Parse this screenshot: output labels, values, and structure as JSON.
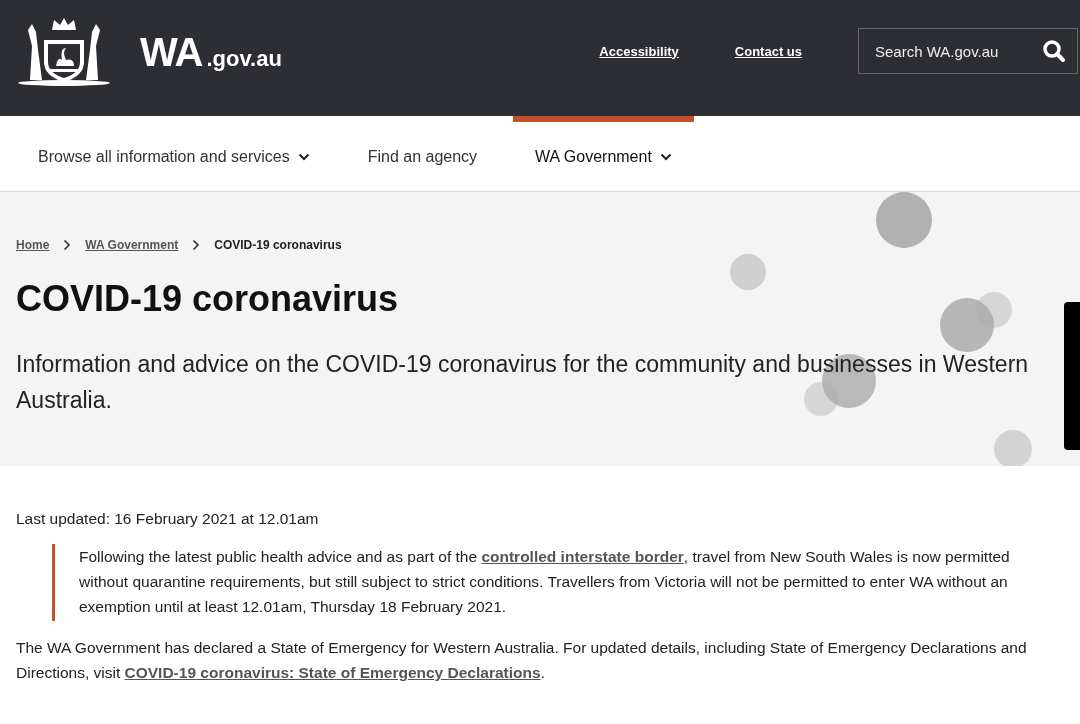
{
  "header": {
    "site_name": "WA",
    "site_suffix": ".gov.au",
    "links": [
      "Accessibility",
      "Contact us"
    ],
    "search": {
      "placeholder": "Search WA.gov.au"
    }
  },
  "nav": [
    {
      "label": "Browse all information and services",
      "dropdown": true,
      "selected": false
    },
    {
      "label": "Find an agency",
      "dropdown": false,
      "selected": false
    },
    {
      "label": "WA Government",
      "dropdown": true,
      "selected": true
    }
  ],
  "breadcrumbs": [
    {
      "label": "Home",
      "link": true
    },
    {
      "label": "WA Government",
      "link": true
    },
    {
      "label": "COVID-19 coronavirus",
      "link": false
    }
  ],
  "title": "COVID-19 coronavirus",
  "intro": "Information and advice on the COVID-19 coronavirus for the community and businesses in Western Australia.",
  "last_updated": "Last updated: 16 February 2021 at 12.01am",
  "notice": {
    "before": "Following the latest public health advice and as part of the ",
    "link": "controlled interstate border",
    "after": ", travel from New South Wales is now permitted without quarantine requirements, but still subject to strict conditions. Travellers from Victoria will not be permitted to enter WA without an exemption until at least 12.01am, Thursday 18 February 2021."
  },
  "paragraph": {
    "before": "The WA Government has declared a State of Emergency for Western Australia. For updated details, including State of Emergency Declarations and Directions, visit ",
    "link": "COVID-19 coronavirus: State of Emergency Declarations",
    "after": "."
  }
}
